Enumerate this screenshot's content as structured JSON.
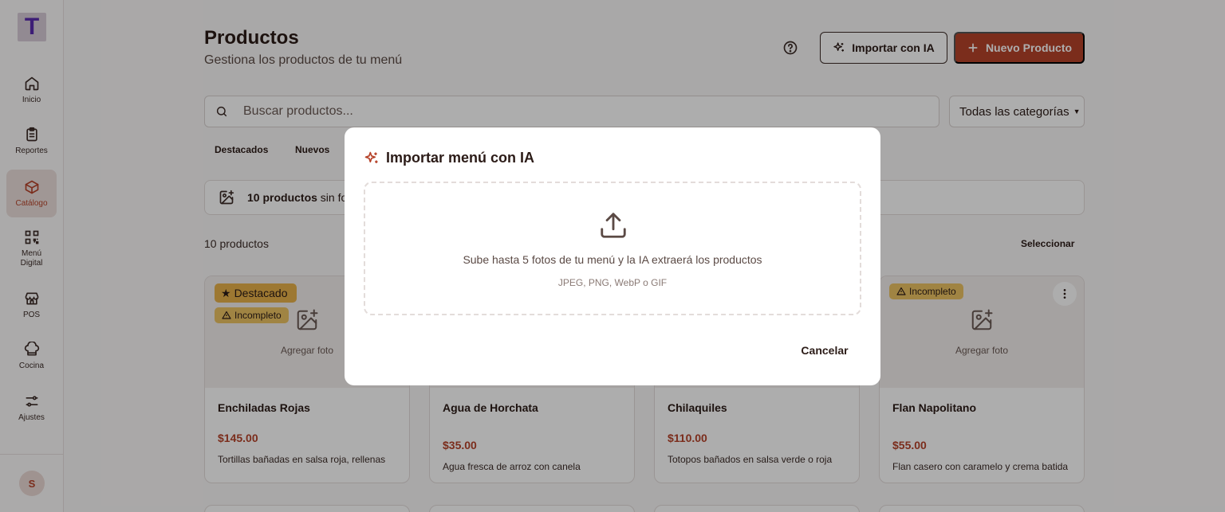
{
  "sidebar": {
    "logo_letter": "T",
    "items": [
      {
        "label": "Inicio",
        "icon": "home-icon"
      },
      {
        "label": "Reportes",
        "icon": "clipboard-icon"
      },
      {
        "label": "Catálogo",
        "icon": "box-icon",
        "active": true
      },
      {
        "label": "Menú Digital",
        "icon": "qr-code-icon"
      },
      {
        "label": "POS",
        "icon": "store-icon"
      },
      {
        "label": "Cocina",
        "icon": "chef-hat-icon"
      },
      {
        "label": "Ajustes",
        "icon": "sliders-icon"
      }
    ],
    "avatar_initial": "S"
  },
  "header": {
    "title": "Productos",
    "subtitle": "Gestiona los productos de tu menú",
    "import_ai_label": "Importar con IA",
    "new_product_label": "Nuevo Producto"
  },
  "search": {
    "placeholder": "Buscar productos...",
    "category_value": "Todas las categorías"
  },
  "tabs": [
    {
      "label": "Destacados"
    },
    {
      "label": "Nuevos"
    }
  ],
  "banner": {
    "count_bold": "10 productos",
    "text_rest": "sin fo"
  },
  "list": {
    "count_label": "10 productos",
    "select_label": "Seleccionar"
  },
  "products": [
    {
      "name": "Enchiladas Rojas",
      "price": "$145.00",
      "description": "Tortillas bañadas en salsa roja, rellenas de pollo con crema y queso",
      "featured": true,
      "incomplete": true,
      "add_photo": "Agregar foto"
    },
    {
      "name": "Agua de Horchata",
      "price": "$35.00",
      "description": "Agua fresca de arroz con canela",
      "featured": false,
      "incomplete": false
    },
    {
      "name": "Chilaquiles",
      "price": "$110.00",
      "description": "Totopos bañados en salsa verde o roja con pollo, crema y queso",
      "featured": false,
      "incomplete": false
    },
    {
      "name": "Flan Napolitano",
      "price": "$55.00",
      "description": "Flan casero con caramelo y crema batida",
      "featured": false,
      "incomplete": true,
      "add_photo": "Agregar foto"
    }
  ],
  "badges": {
    "featured": "Destacado",
    "incomplete": "Incompleto"
  },
  "modal": {
    "title": "Importar menú con IA",
    "upload_text": "Sube hasta 5 fotos de tu menú y la IA extraerá los productos",
    "formats": "JPEG, PNG, WebP o GIF",
    "cancel_label": "Cancelar"
  },
  "colors": {
    "accent": "#b6432a",
    "badge_featured": "#e8b24a",
    "badge_incomplete": "#ecc363",
    "logo": "#5b2cae"
  }
}
